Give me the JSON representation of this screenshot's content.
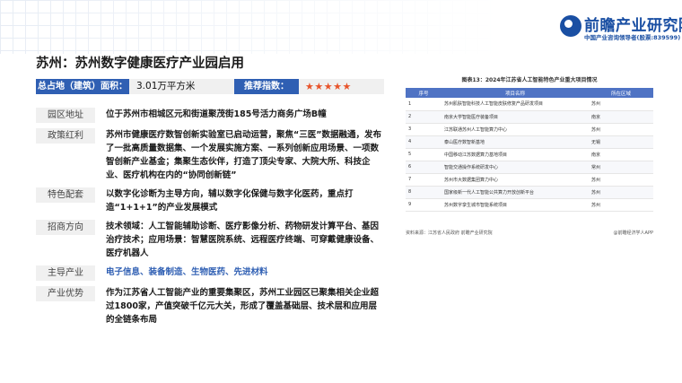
{
  "brand": {
    "name": "前瞻产业研究院",
    "subtitle": "中国产业咨询领导者(股票:839599)"
  },
  "title": "苏州：苏州数字健康医疗产业园启用",
  "stats": {
    "area_label": "总占地（建筑）面积：",
    "area_value": "3.01万平方米",
    "rating_label": "推荐指数：",
    "stars": "★★★★★",
    "rating_count": 5
  },
  "rows": [
    {
      "label": "园区地址",
      "text": "位于苏州市相城区元和街道聚茂街185号活力商务广场B幢"
    },
    {
      "label": "政策红利",
      "text": "苏州市健康医疗数智创新实验室已启动运营，聚焦“三医”数据融通，发布了一批高质量数据集、一个发展实施方案、一系列创新应用场景、一项数智创新产业基金；集聚生态伙伴，打造了顶尖专家、大院大所、科技企业、医疗机构在内的“协同创新链”"
    },
    {
      "label": "特色配套",
      "text": "以数字化诊断为主导方向，辅以数字化保健与数字化医药，重点打造“1+1+1”的产业发展模式"
    },
    {
      "label": "招商方向",
      "text": "技术领域：人工智能辅助诊断、医疗影像分析、药物研发计算平台、基因治疗技术；应用场景：智慧医院系统、远程医疗终端、可穿戴健康设备、医疗机器人"
    },
    {
      "label": "主导产业",
      "text": "电子信息、装备制造、生物医药、先进材料",
      "highlight": true
    },
    {
      "label": "产业优势",
      "text": "作为江苏省人工智能产业的重要集聚区，苏州工业园区已聚集相关企业超过1800家，产值突破千亿元大关，形成了覆盖基础层、技术层和应用层的全链条布局"
    }
  ],
  "figure": {
    "title": "图表13：2024年江苏省人工智能特色产业重大项目情况",
    "headers": [
      "序号",
      "项目名称",
      "所在区域"
    ],
    "rows": [
      [
        "1",
        "苏州肌肤智能科技人工智能皮肤修复产品研发项目",
        "苏州"
      ],
      [
        "2",
        "南京大学智能医疗装备项目",
        "南京"
      ],
      [
        "3",
        "江苏联通苏州人工智能算力中心",
        "苏州"
      ],
      [
        "4",
        "泰山医疗数智新基地",
        "无锡"
      ],
      [
        "5",
        "中国移动江苏数据算力基地项目",
        "南京"
      ],
      [
        "6",
        "智能交通操作系统研发中心",
        "常州"
      ],
      [
        "7",
        "苏州市大数据集团算力中心",
        "苏州"
      ],
      [
        "8",
        "国家级新一代人工智能公共算力开放创新平台",
        "苏州"
      ],
      [
        "9",
        "苏州数字孪生城市智能系统项目",
        "苏州"
      ]
    ],
    "source": "资料来源：江苏省人民政府 前瞻产业研究院",
    "credit": "@前瞻经济学人APP"
  }
}
